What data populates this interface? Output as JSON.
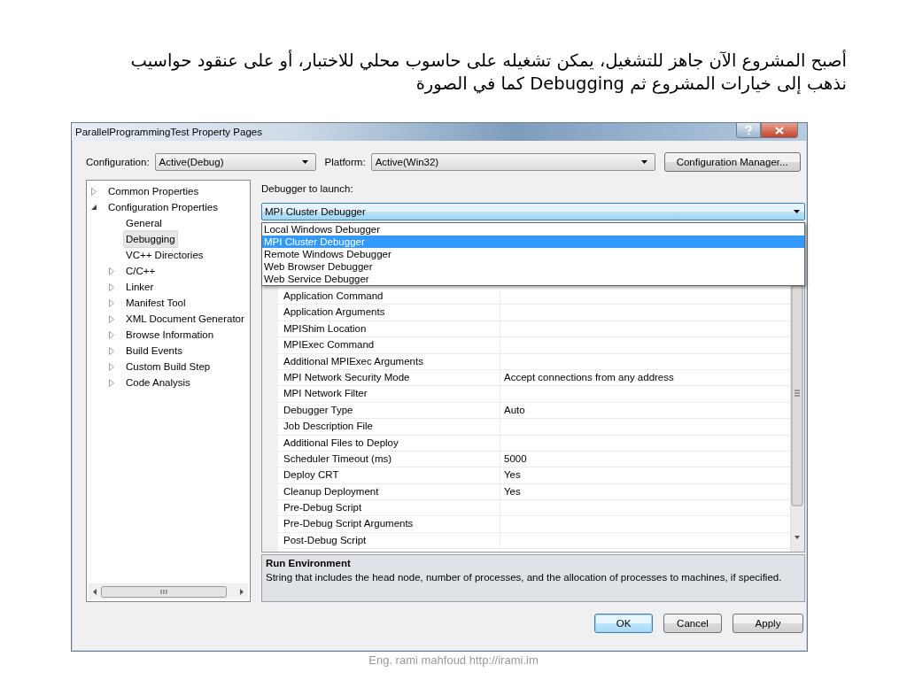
{
  "caption_lines": [
    "أصبح المشروع الآن جاهز للتشغيل، يمكن تشغيله على حاسوب محلي للاختبار، أو على عنقود حواسيب",
    "نذهب إلى خيارات المشروع ثم  Debugging كما في الصورة"
  ],
  "window": {
    "title": "ParallelProgrammingTest Property Pages"
  },
  "configuration": {
    "label": "Configuration:",
    "value": "Active(Debug)"
  },
  "platform": {
    "label": "Platform:",
    "value": "Active(Win32)"
  },
  "configuration_manager_button": "Configuration Manager...",
  "tree": [
    {
      "label": "Common Properties",
      "expanded": false,
      "selected": false
    },
    {
      "label": "Configuration Properties",
      "expanded": true,
      "selected": false,
      "children": [
        {
          "label": "General",
          "selected": false
        },
        {
          "label": "Debugging",
          "selected": true
        },
        {
          "label": "VC++ Directories",
          "selected": false
        },
        {
          "label": "C/C++",
          "expanded": false,
          "selected": false
        },
        {
          "label": "Linker",
          "expanded": false,
          "selected": false
        },
        {
          "label": "Manifest Tool",
          "expanded": false,
          "selected": false
        },
        {
          "label": "XML Document Generator",
          "expanded": false,
          "selected": false
        },
        {
          "label": "Browse Information",
          "expanded": false,
          "selected": false
        },
        {
          "label": "Build Events",
          "expanded": false,
          "selected": false
        },
        {
          "label": "Custom Build Step",
          "expanded": false,
          "selected": false
        },
        {
          "label": "Code Analysis",
          "expanded": false,
          "selected": false
        }
      ]
    }
  ],
  "debugger": {
    "label": "Debugger to launch:",
    "value": "MPI Cluster Debugger",
    "expanded": true,
    "options": [
      {
        "label": "Local Windows Debugger",
        "selected": false
      },
      {
        "label": "MPI Cluster Debugger",
        "selected": true
      },
      {
        "label": "Remote Windows Debugger",
        "selected": false
      },
      {
        "label": "Web Browser Debugger",
        "selected": false
      },
      {
        "label": "Web Service Debugger",
        "selected": false
      }
    ]
  },
  "properties": [
    {
      "name": "Application Command"
    },
    {
      "name": "Application Arguments"
    },
    {
      "name": "MPIShim Location"
    },
    {
      "name": "MPIExec Command"
    },
    {
      "name": "Additional MPIExec Arguments"
    },
    {
      "name": "MPI Network Security Mode",
      "value": "Accept connections from any address"
    },
    {
      "name": "MPI Network Filter"
    },
    {
      "name": "Debugger Type",
      "value": "Auto"
    },
    {
      "name": "Job Description File"
    },
    {
      "name": "Additional Files to Deploy"
    },
    {
      "name": "Scheduler Timeout (ms)",
      "value": "5000"
    },
    {
      "name": "Deploy CRT",
      "value": "Yes"
    },
    {
      "name": "Cleanup Deployment",
      "value": "Yes"
    },
    {
      "name": "Pre-Debug Script"
    },
    {
      "name": "Pre-Debug Script Arguments"
    },
    {
      "name": "Post-Debug Script"
    }
  ],
  "description": {
    "title": "Run Environment",
    "text": "String that includes the head node, number of processes, and the allocation of processes to machines, if specified."
  },
  "buttons": [
    {
      "label": "OK",
      "default": true
    },
    {
      "label": "Cancel",
      "default": false
    },
    {
      "label": "Apply",
      "default": false
    }
  ],
  "footer": "Eng. rami mahfoud http://irami.im"
}
